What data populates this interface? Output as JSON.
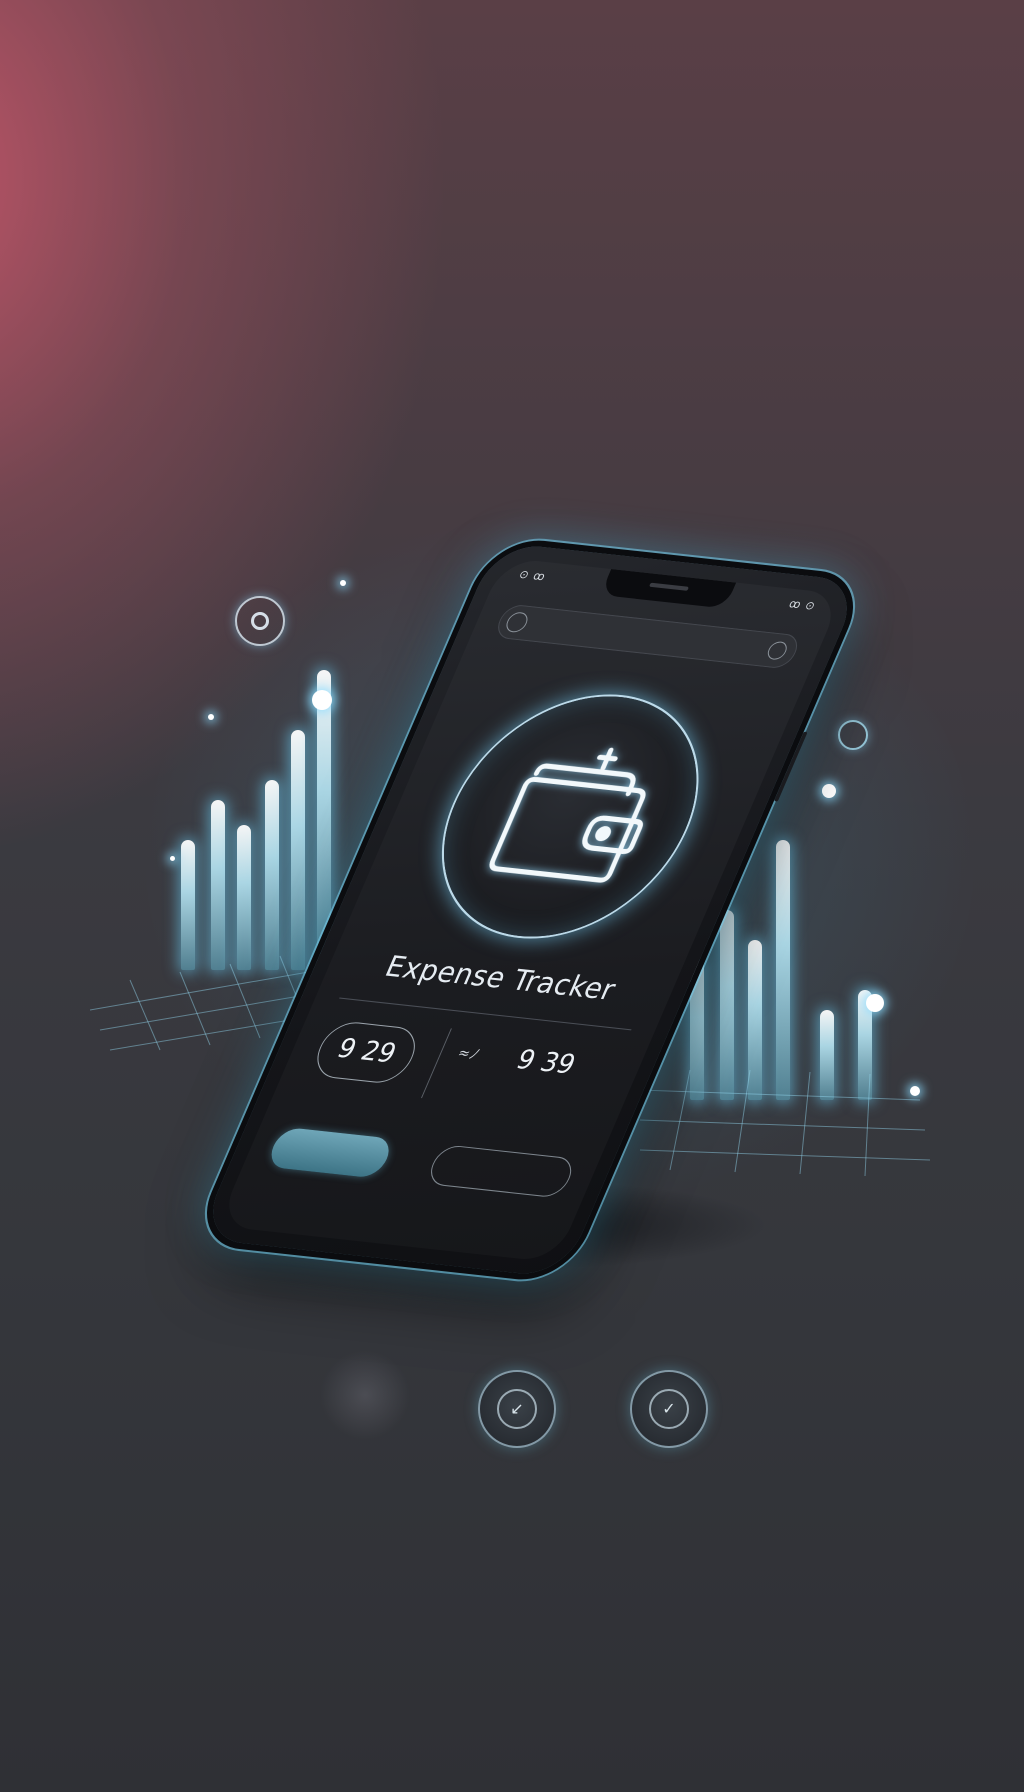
{
  "app": {
    "title": "Expense Tracker"
  },
  "status_bar": {
    "left": "⊙ ꝏ",
    "right": "ꝏ ⊙"
  },
  "stats": {
    "left_value": "9 29",
    "middle_label": "",
    "right_value": "9 39",
    "right_label": ""
  },
  "buttons": {
    "primary_label": "",
    "secondary_label": ""
  },
  "icons": {
    "wallet": "wallet-icon",
    "search": "search-icon",
    "settings": "circle-icon"
  },
  "colors": {
    "accent_glow": "#6fd2f5",
    "background_warm": "#c4566a",
    "background_dark": "#2f3035"
  }
}
